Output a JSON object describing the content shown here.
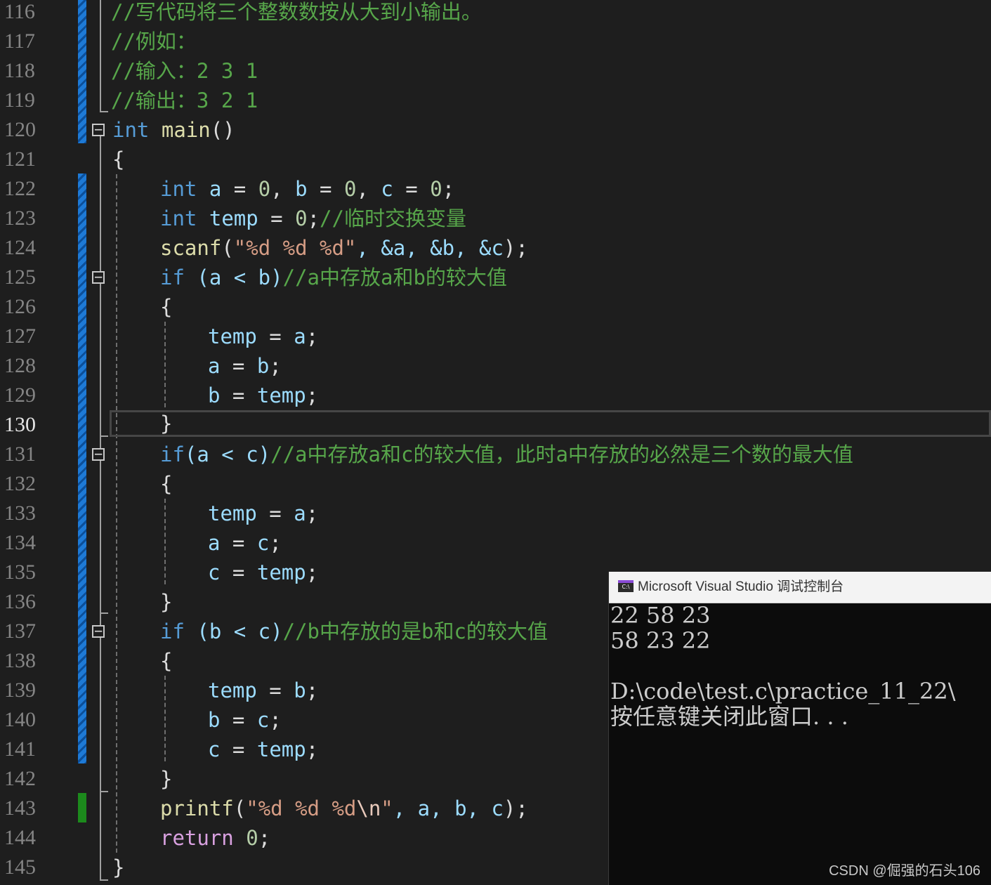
{
  "editor": {
    "current_line": "130",
    "line_numbers": [
      "116",
      "117",
      "118",
      "119",
      "120",
      "121",
      "122",
      "123",
      "124",
      "125",
      "126",
      "127",
      "128",
      "129",
      "130",
      "131",
      "132",
      "133",
      "134",
      "135",
      "136",
      "137",
      "138",
      "139",
      "140",
      "141",
      "142",
      "143",
      "144",
      "145"
    ],
    "lines": {
      "l116": {
        "comment": "//写代码将三个整数数按从大到小输出。"
      },
      "l117": {
        "comment": "//例如："
      },
      "l118": {
        "comment": "//输入：2 3 1"
      },
      "l119": {
        "comment": "//输出：3 2 1"
      },
      "l120": {
        "kw": "int",
        "fn": "main",
        "rest": "()"
      },
      "l121": {
        "brace": "{"
      },
      "l122": {
        "kw": "int",
        "a": "a",
        "eq1": " = ",
        "n1": "0",
        "sep1": ", ",
        "b": "b",
        "eq2": " = ",
        "n2": "0",
        "sep2": ", ",
        "c": "c",
        "eq3": " = ",
        "n3": "0",
        "end": ";"
      },
      "l123": {
        "kw": "int",
        "var": "temp",
        "eq": " = ",
        "num": "0",
        "end": ";",
        "comment": "//临时交换变量"
      },
      "l124": {
        "fn": "scanf",
        "open": "(",
        "str": "\"%d %d %d\"",
        "args": ", &a, &b, &c",
        "close": ");"
      },
      "l125": {
        "kw": "if",
        "cond": " (a < b)",
        "comment": "//a中存放a和b的较大值"
      },
      "l126": {
        "brace": "{"
      },
      "l127": {
        "var": "temp",
        "eq": " = ",
        "val": "a",
        "end": ";"
      },
      "l128": {
        "var": "a",
        "eq": " = ",
        "val": "b",
        "end": ";"
      },
      "l129": {
        "var": "b",
        "eq": " = ",
        "val": "temp",
        "end": ";"
      },
      "l130": {
        "brace": "}"
      },
      "l131": {
        "kw": "if",
        "cond": "(a < c)",
        "comment": "//a中存放a和c的较大值，此时a中存放的必然是三个数的最大值"
      },
      "l132": {
        "brace": "{"
      },
      "l133": {
        "var": "temp",
        "eq": " = ",
        "val": "a",
        "end": ";"
      },
      "l134": {
        "var": "a",
        "eq": " = ",
        "val": "c",
        "end": ";"
      },
      "l135": {
        "var": "c",
        "eq": " = ",
        "val": "temp",
        "end": ";"
      },
      "l136": {
        "brace": "}"
      },
      "l137": {
        "kw": "if",
        "cond": " (b < c)",
        "comment": "//b中存放的是b和c的较大值"
      },
      "l138": {
        "brace": "{"
      },
      "l139": {
        "var": "temp",
        "eq": " = ",
        "val": "b",
        "end": ";"
      },
      "l140": {
        "var": "b",
        "eq": " = ",
        "val": "c",
        "end": ";"
      },
      "l141": {
        "var": "c",
        "eq": " = ",
        "val": "temp",
        "end": ";"
      },
      "l142": {
        "brace": "}"
      },
      "l143": {
        "fn": "printf",
        "open": "(",
        "str": "\"%d %d %d",
        "esc": "\\n",
        "str_end": "\"",
        "args": ", a, b, c",
        "close": ");"
      },
      "l144": {
        "kw": "return",
        "num": "0",
        "end": ";"
      },
      "l145": {
        "brace": "}"
      }
    },
    "fold_symbol": "−",
    "colors": {
      "background": "#1e1e1e",
      "keyword": "#569cd6",
      "return_keyword": "#d8a0df",
      "function": "#dcdcaa",
      "variable": "#9cdcfe",
      "number": "#b5cea8",
      "string": "#d69d85",
      "comment": "#57a64a",
      "changed_bar": "#1e7ad6",
      "saved_bar": "#1c8a1c"
    }
  },
  "console": {
    "icon": "console-app-icon",
    "icon_text": "C:\\",
    "title": "Microsoft Visual Studio 调试控制台",
    "output_lines": [
      "22 58 23",
      "58 23 22",
      "",
      "D:\\code\\test.c\\practice_11_22\\",
      "按任意键关闭此窗口. . ."
    ]
  },
  "watermark": "CSDN @倔强的石头106"
}
